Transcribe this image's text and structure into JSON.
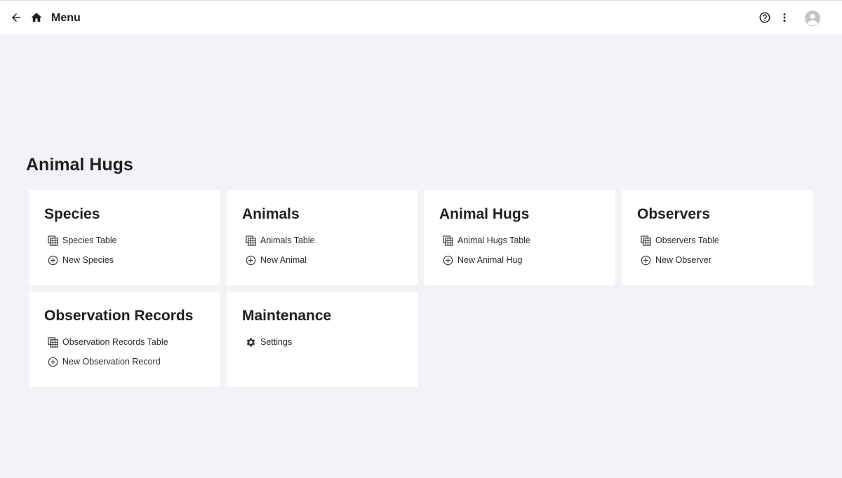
{
  "topbar": {
    "title": "Menu",
    "icons": [
      "back-arrow-icon",
      "home-icon",
      "help-circle-icon",
      "more-vertical-icon",
      "account-avatar-icon"
    ]
  },
  "app": {
    "title": "Animal Hugs"
  },
  "cards": [
    {
      "title": "Species",
      "links": [
        {
          "label": "Species Table",
          "icon": "table-icon"
        },
        {
          "label": "New Species",
          "icon": "add-circle-icon"
        }
      ]
    },
    {
      "title": "Animals",
      "links": [
        {
          "label": "Animals Table",
          "icon": "table-icon"
        },
        {
          "label": "New Animal",
          "icon": "add-circle-icon"
        }
      ]
    },
    {
      "title": "Animal Hugs",
      "links": [
        {
          "label": "Animal Hugs Table",
          "icon": "table-icon"
        },
        {
          "label": "New Animal Hug",
          "icon": "add-circle-icon"
        }
      ]
    },
    {
      "title": "Observers",
      "links": [
        {
          "label": "Observers Table",
          "icon": "table-icon"
        },
        {
          "label": "New Observer",
          "icon": "add-circle-icon"
        }
      ]
    },
    {
      "title": "Observation Records",
      "links": [
        {
          "label": "Observation Records Table",
          "icon": "table-icon"
        },
        {
          "label": "New Observation Record",
          "icon": "add-circle-icon"
        }
      ]
    },
    {
      "title": "Maintenance",
      "links": [
        {
          "label": "Settings",
          "icon": "gear-icon"
        }
      ]
    }
  ],
  "colors": {
    "background": "#f2f3f7",
    "surface": "#ffffff",
    "text": "#1f1f1f",
    "avatar": "#c4c4c4"
  }
}
